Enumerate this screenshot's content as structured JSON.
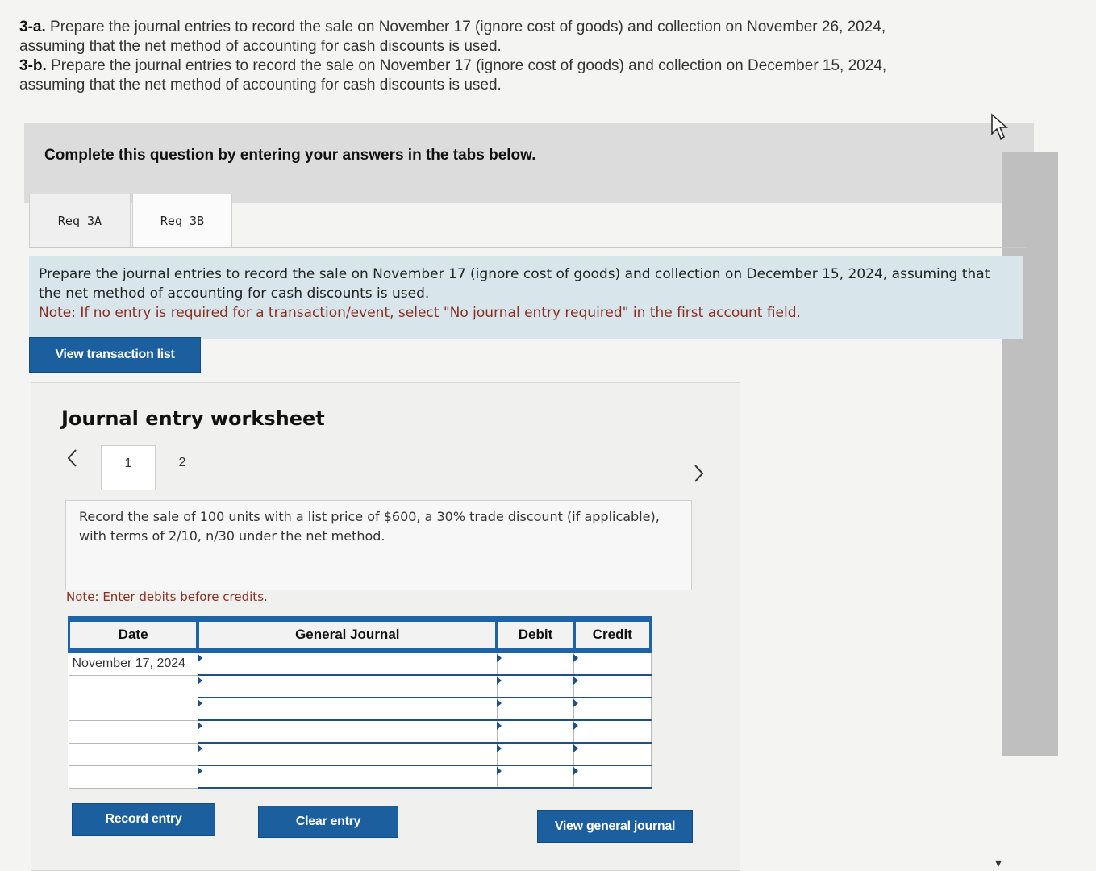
{
  "question": {
    "a_label": "3-a.",
    "a_text_1": " Prepare the journal entries to record the sale on November 17 (ignore cost of goods) and collection on November 26, 2024,",
    "a_text_2": "assuming that the net method of accounting for cash discounts is used.",
    "b_label": "3-b.",
    "b_text_1": " Prepare the journal entries to record the sale on November 17 (ignore cost of goods) and collection on December 15, 2024,",
    "b_text_2": "assuming that the net method of accounting for cash discounts is used."
  },
  "banner": {
    "text": "Complete this question by entering your answers in the tabs below."
  },
  "tabs": [
    {
      "label": "Req 3A"
    },
    {
      "label": "Req 3B"
    }
  ],
  "instructions": {
    "line1": "Prepare the journal entries to record the sale on November 17 (ignore cost of goods) and collection on December 15, 2024, assuming that the net method of accounting for cash discounts is used.",
    "note": "Note: If no entry is required for a transaction/event, select \"No journal entry required\" in the first account field."
  },
  "buttons": {
    "view_transactions": "View transaction list",
    "record": "Record entry",
    "clear": "Clear entry",
    "view_journal": "View general journal"
  },
  "worksheet": {
    "title": "Journal entry worksheet",
    "pages": [
      "1",
      "2"
    ],
    "prev_icon": "<",
    "next_icon": ">",
    "description": "Record the sale of 100 units with a list price of $600, a 30% trade discount (if applicable), with terms of 2/10, n/30 under the net method.",
    "debit_note": "Note: Enter debits before credits."
  },
  "journal": {
    "headers": {
      "date": "Date",
      "general": "General Journal",
      "debit": "Debit",
      "credit": "Credit"
    },
    "rows": [
      {
        "date": "November 17, 2024",
        "account": "",
        "debit": "",
        "credit": ""
      },
      {
        "date": "",
        "account": "",
        "debit": "",
        "credit": ""
      },
      {
        "date": "",
        "account": "",
        "debit": "",
        "credit": ""
      },
      {
        "date": "",
        "account": "",
        "debit": "",
        "credit": ""
      },
      {
        "date": "",
        "account": "",
        "debit": "",
        "credit": ""
      },
      {
        "date": "",
        "account": "",
        "debit": "",
        "credit": ""
      }
    ]
  },
  "icons": {
    "cursor": "cursor-pointer-icon",
    "scroll_down": "chevron-down-icon"
  }
}
